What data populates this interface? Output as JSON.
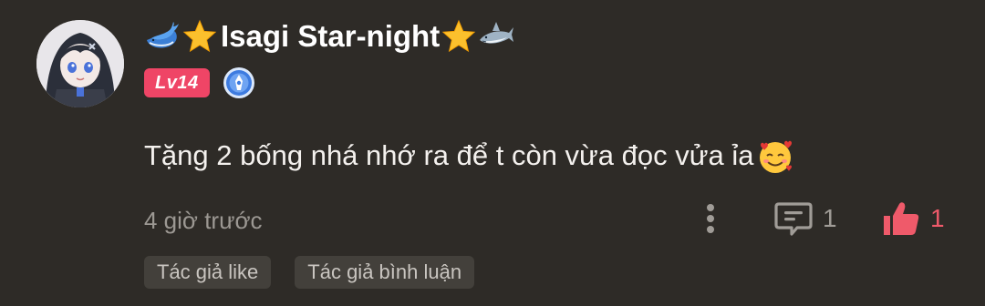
{
  "comment": {
    "username": "Isagi Star-night",
    "username_prefix_emojis": [
      "whale-emoji",
      "star-emoji"
    ],
    "username_suffix_emojis": [
      "star-emoji",
      "shark-emoji"
    ],
    "level": "Lv14",
    "medal_icon": "medal-badge-icon",
    "text": "Tặng 2 bống nhá nhớ ra để t còn vừa đọc vửa ỉa",
    "text_emoji": "smiling-face-with-hearts-emoji",
    "timestamp": "4 giờ trước",
    "reply_count": "1",
    "like_count": "1",
    "tags": [
      "Tác giả like",
      "Tác giả bình luận"
    ],
    "colors": {
      "background": "#2e2b27",
      "level_badge": "#ef4566",
      "like": "#ef5a6a",
      "muted_text": "#9c9893",
      "tag_background": "#43403b"
    }
  }
}
